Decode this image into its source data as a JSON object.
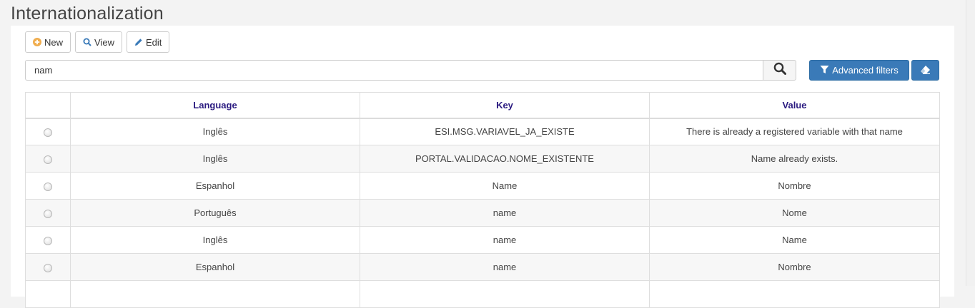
{
  "page": {
    "title": "Internationalization"
  },
  "toolbar": {
    "new_label": "New",
    "view_label": "View",
    "edit_label": "Edit"
  },
  "search": {
    "value": "nam",
    "placeholder": ""
  },
  "filters": {
    "advanced_label": "Advanced filters"
  },
  "colors": {
    "accent": "#3a7ab8",
    "header_text": "#2a1a80",
    "new_icon": "#f0ad4e",
    "icon_blue": "#3a7ab8"
  },
  "icons": {
    "new": "plus-circle-icon",
    "view": "search-icon",
    "edit": "pencil-icon",
    "search": "search-icon",
    "filter": "filter-icon",
    "clear": "eraser-icon"
  },
  "table": {
    "columns": [
      "",
      "Language",
      "Key",
      "Value"
    ],
    "rows": [
      {
        "language": "Inglês",
        "key": "ESI.MSG.VARIAVEL_JA_EXISTE",
        "value": "There is already a registered variable with that name"
      },
      {
        "language": "Inglês",
        "key": "PORTAL.VALIDACAO.NOME_EXISTENTE",
        "value": "Name already exists."
      },
      {
        "language": "Espanhol",
        "key": "Name",
        "value": "Nombre"
      },
      {
        "language": "Português",
        "key": "name",
        "value": "Nome"
      },
      {
        "language": "Inglês",
        "key": "name",
        "value": "Name"
      },
      {
        "language": "Espanhol",
        "key": "name",
        "value": "Nombre"
      }
    ]
  }
}
